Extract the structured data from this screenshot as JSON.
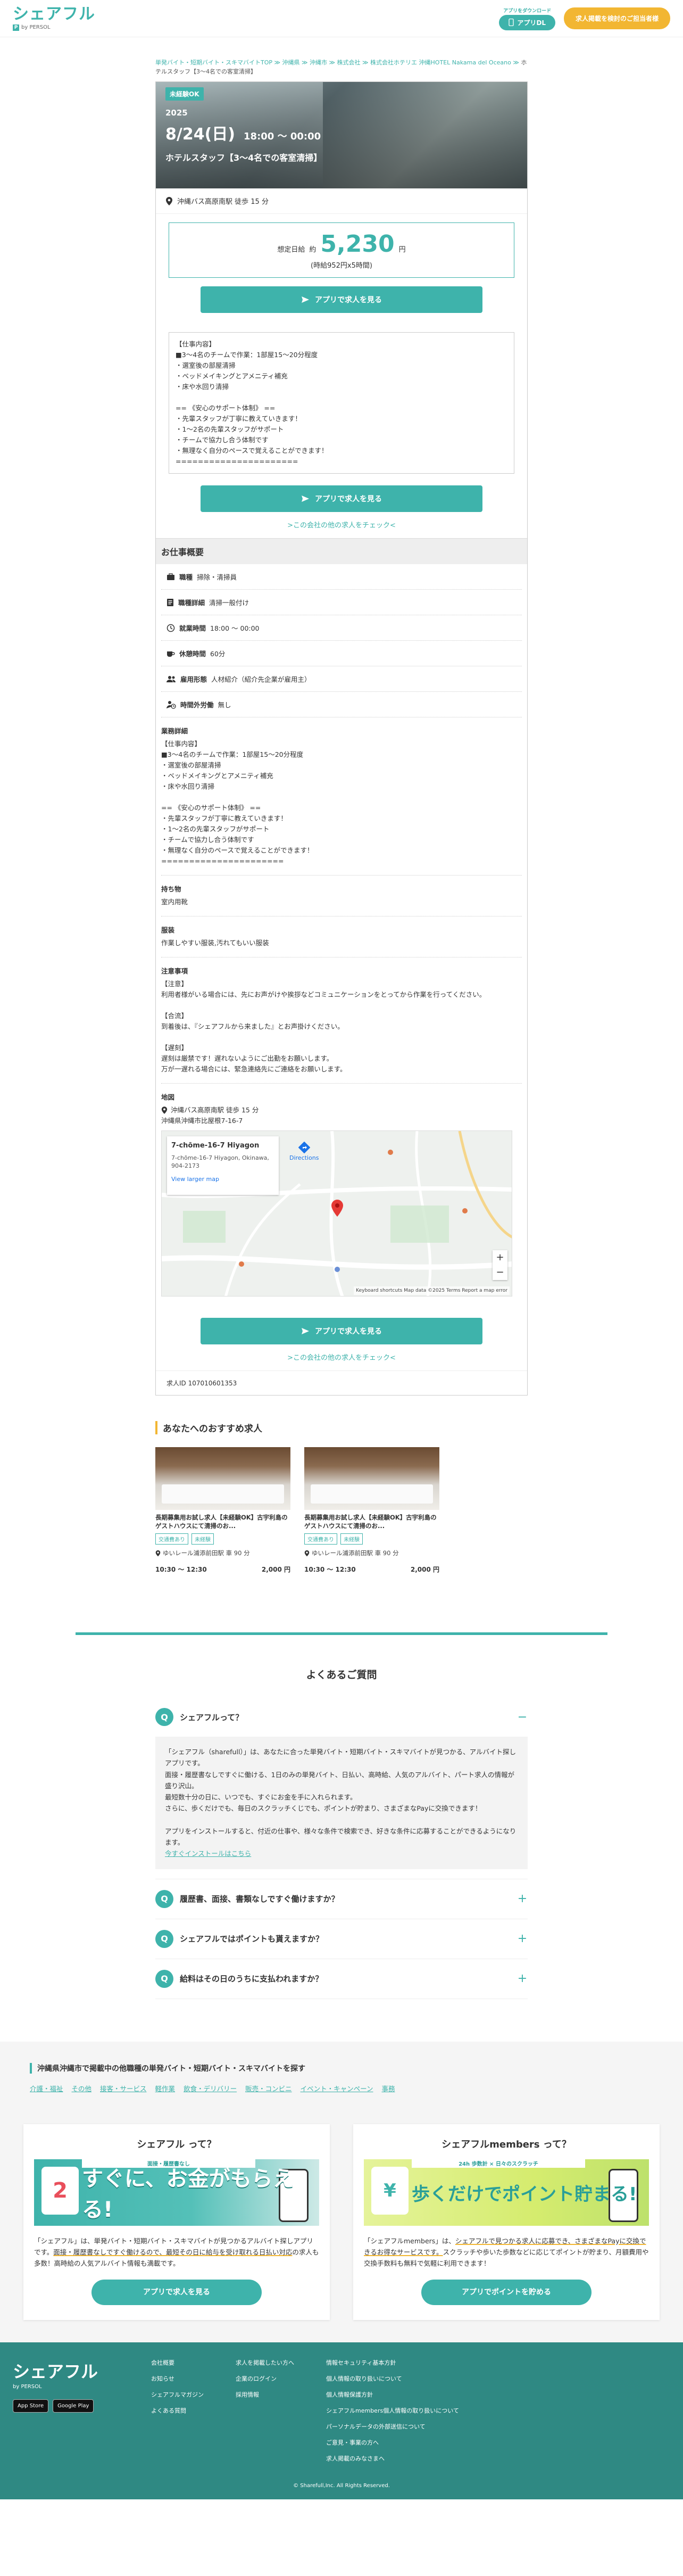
{
  "header": {
    "logo": "シェアフル",
    "logo_sub": "by PERSOL",
    "app_note": "アプリをダウンロード",
    "app_btn": "アプリDL",
    "register_btn": "求人掲載を検討のご担当者様"
  },
  "breadcrumb": {
    "path": "単発バイト・短期バイト・スキマバイトTOP ≫ 沖縄県 ≫ 沖縄市 ≫ 株式会社 ≫ 株式会社ホテリエ 沖縄HOTEL Nakama del Oceano ≫ ",
    "current": "ホテルスタッフ【3〜4名での客室清掃】"
  },
  "job": {
    "badge": "未経験OK",
    "year": "2025",
    "date": "8/24(日)",
    "time": "18:00 〜 00:00",
    "title": "ホテルスタッフ【3〜4名での客室清掃】",
    "access": "沖縄バス高原南駅 徒歩 15 分",
    "pay_label": "想定日給",
    "pay_approx": "約",
    "pay_amount": "5,230",
    "pay_unit": "円",
    "pay_sub": "(時給952円x5時間)",
    "cta": "アプリで求人を見る",
    "description": "【仕事内容】\n■3〜4名のチームで作業：1部屋15〜20分程度\n・選室後の部屋清掃\n・ベッドメイキングとアメニティ補充\n・床や水回り清掃\n\n== 《安心のサポート体制》 ==\n・先輩スタッフが丁寧に教えていきます！\n・1〜2名の先輩スタッフがサポート\n・チームで協力し合う体制です\n・無理なく自分のペースで覚えることができます！\n======================",
    "more_link": ">この会社の他の求人をチェック<",
    "id_label": "求人ID",
    "id_value": "107010601353"
  },
  "overview": {
    "head": "お仕事概要",
    "rows": [
      {
        "label": "職種",
        "value": "掃除・清掃員"
      },
      {
        "label": "職種詳細",
        "value": "清掃一般付け"
      },
      {
        "label": "就業時間",
        "value": "18:00 〜 00:00"
      },
      {
        "label": "休憩時間",
        "value": "60分"
      },
      {
        "label": "雇用形態",
        "value": "人材紹介（紹介先企業が雇用主）"
      },
      {
        "label": "時間外労働",
        "value": "無し"
      }
    ],
    "work_title": "業務詳細",
    "work_body": "【仕事内容】\n■3〜4名のチームで作業：1部屋15〜20分程度\n・選室後の部屋清掃\n・ベッドメイキングとアメニティ補充\n・床や水回り清掃\n\n== 《安心のサポート体制》 ==\n・先輩スタッフが丁寧に教えていきます！\n・1〜2名の先輩スタッフがサポート\n・チームで協力し合う体制です\n・無理なく自分のペースで覚えることができます！\n======================",
    "items_title": "持ち物",
    "items_body": "室内用靴",
    "dress_title": "服装",
    "dress_body": "作業しやすい服装,汚れてもいい服装",
    "notice_title": "注意事項",
    "notice_body": "【注意】\n利用者様がいる場合には、先にお声がけや挨拶などコミュニケーションをとってから作業を行ってください。\n\n【合流】\n到着後は、『シェアフルから来ました』とお声掛けください。\n\n【遅刻】\n遅刻は厳禁です！遅れないようにご出勤をお願いします。\n万が一遅れる場合には、緊急連絡先にご連絡をお願いします。",
    "map_title": "地図",
    "map_access": "沖縄バス高原南駅 徒歩 15 分",
    "map_address": "沖縄県沖縄市比屋根7-16-7",
    "map_card_title": "7-chōme-16-7 Hiyagon",
    "map_card_addr": "7-chōme-16-7 Hiyagon, Okinawa, 904-2173",
    "map_card_link": "View larger map",
    "map_dir": "Directions",
    "map_foot": "Keyboard shortcuts   Map data ©2025   Terms   Report a map error"
  },
  "recommend": {
    "head": "あなたへのおすすめ求人",
    "cards": [
      {
        "title": "長期募集用お試し求人【未経験OK】古宇利島のゲストハウスにて清掃のお...",
        "tags": [
          "交通費あり",
          "未経験"
        ],
        "access": "ゆいレール浦添前田駅 車 90 分",
        "time": "10:30 〜 12:30",
        "pay": "2,000 円"
      },
      {
        "title": "長期募集用お試し求人【未経験OK】古宇利島のゲストハウスにて清掃のお...",
        "tags": [
          "交通費あり",
          "未経験"
        ],
        "access": "ゆいレール浦添前田駅 車 90 分",
        "time": "10:30 〜 12:30",
        "pay": "2,000 円"
      }
    ]
  },
  "faq": {
    "title": "よくあるご質問",
    "items": [
      {
        "q": "シェアフルって？",
        "toggle": "−",
        "a": "「シェアフル（sharefull）」は、あなたに合った単発バイト・短期バイト・スキマバイトが見つかる、アルバイト探しアプリです。\n面接・履歴書なしですぐに働ける、1日のみの単発バイト、日払い、高時給、人気のアルバイト、パート求人の情報が盛り沢山。\n最短数十分の日に、いつでも、すぐにお金を手に入れられます。\nさらに、歩くだけでも、毎日のスクラッチくじでも、ポイントが貯まり、さまざまなPayに交換できます！\n\nアプリをインストールすると、付近の仕事や、様々な条件で検索でき、好きな条件に応募することができるようになります。",
        "link": "今すぐインストールはこちら"
      },
      {
        "q": "履歴書、面接、書類なしですぐ働けますか？",
        "toggle": "+"
      },
      {
        "q": "シェアフルではポイントも貰えますか？",
        "toggle": "+"
      },
      {
        "q": "給料はその日のうちに支払われますか？",
        "toggle": "+"
      }
    ]
  },
  "cities": {
    "head": "沖縄県沖縄市で掲載中の他職種の単発バイト・短期バイト・スキマバイトを探す",
    "list": [
      "介護・福祉",
      "その他",
      "接客・サービス",
      "軽作業",
      "飲食・デリバリー",
      "販売・コンビニ",
      "イベント・キャンペーン",
      "事務"
    ]
  },
  "promo": [
    {
      "title": "シェアフル って？",
      "banner_text": "すぐに、お金がもらえる!",
      "ribbon": "面接・履歴書なし",
      "badge": "2",
      "text_a": "「シェアフル」は、単発バイト・短期バイト・スキマバイトが見つかるアルバイト探しアプリです。",
      "text_b": "面接・履歴書なしですぐ働けるので、最短その日に給与を受け取れる日払い対応",
      "text_c": "の求人も多数！高時給の人気アルバイト情報も満載です。",
      "btn": "アプリで求人を見る"
    },
    {
      "title": "シェアフルmembers って？",
      "banner_text": "歩くだけでポイント貯まる!",
      "ribbon": "24h 歩数計 × 日々のスクラッチ",
      "badge": "¥",
      "text_a": "「シェアフルmembers」は、",
      "text_b": "シェアフルで見つかる求人に応募でき、さまざまなPayに交換できるお得なサービスです。",
      "text_c": "スクラッチや歩いた歩数などに応じてポイントが貯まり、月額費用や交換手数料も無料で気軽に利用できます！",
      "btn": "アプリでポイントを貯める"
    }
  ],
  "footer": {
    "logo": "シェアフル",
    "logo_sub": "by PERSOL",
    "store1": "App Store",
    "store2": "Google Play",
    "col1": [
      "会社概要",
      "お知らせ",
      "シェアフルマガジン",
      "よくある質問"
    ],
    "col2": [
      "求人を掲載したい方へ",
      "企業のログイン",
      "採用情報"
    ],
    "col3": [
      "情報セキュリティ基本方針",
      "個人情報の取り扱いについて",
      "個人情報保護方針",
      "シェアフルmembers個人情報の取り扱いについて",
      "パーソナルデータの外部送信について",
      "ご意見・事業の方へ",
      "求人掲載のみなさまへ"
    ],
    "copyright": "© Sharefull,Inc. All Rights Reserved."
  }
}
